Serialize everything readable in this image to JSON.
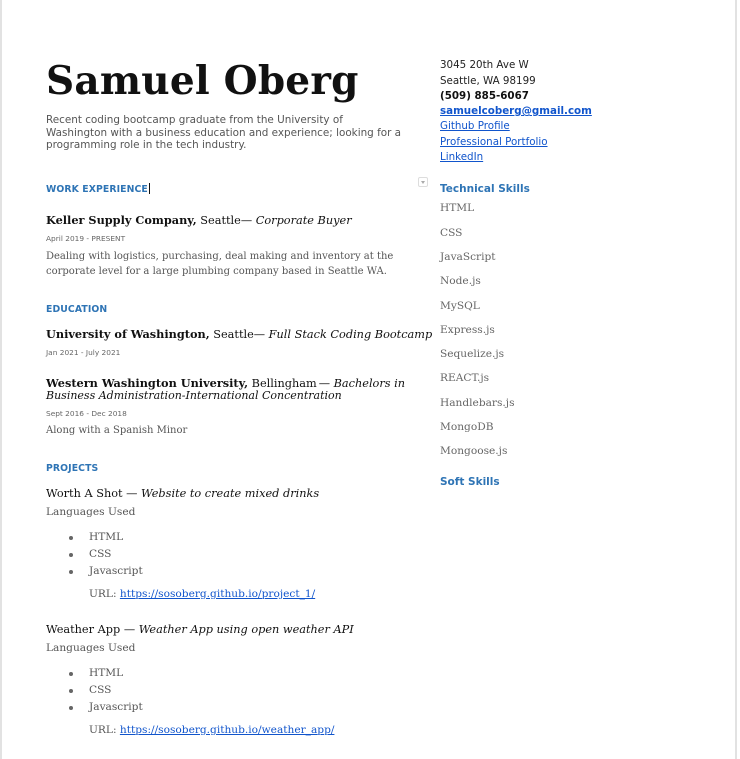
{
  "header": {
    "name": "Samuel Oberg",
    "summary": "Recent coding bootcamp graduate from the University of Washington with a business education and experience; looking for a programming role in the tech industry."
  },
  "contact": {
    "street": "3045 20th Ave W",
    "city": "Seattle, WA 98199",
    "phone": "(509) 885-6067",
    "email": "samuelcoberg@gmail.com",
    "github": "Github Profile",
    "portfolio": "Professional Portfolio",
    "linkedin": "LinkedIn"
  },
  "work": {
    "heading": "WORK EXPERIENCE",
    "jobs": [
      {
        "company": "Keller Supply Company,",
        "location": " Seattle",
        "role": "— Corporate Buyer",
        "dates": "April 2019 - PRESENT",
        "description": "Dealing with logistics, purchasing, deal making and inventory at the corporate level for a large plumbing company based in Seattle WA."
      }
    ]
  },
  "education": {
    "heading": "EDUCATION",
    "schools": [
      {
        "school": "University of Washington,",
        "location": " Seattle",
        "program": "— Full Stack Coding Bootcamp",
        "dates": "Jan 2021 - July 2021"
      },
      {
        "school": "Western Washington University,",
        "location": " Bellingham",
        "program": "— Bachelors in",
        "program_line2": "Business Administration-International Concentration",
        "dates": "Sept 2016 - Dec 2018",
        "note": "Along with a Spanish Minor"
      }
    ]
  },
  "projects": {
    "heading": "PROJECTS",
    "items": [
      {
        "name": "Worth A Shot",
        "dash": " — ",
        "desc": "Website to create mixed drinks",
        "languages_label": "Languages Used",
        "languages": [
          "HTML",
          "CSS",
          "Javascript"
        ],
        "url_label": "URL: ",
        "url": "https://sosoberg.github.io/project_1/"
      },
      {
        "name": "Weather App",
        "dash": " — ",
        "desc": "Weather App using open weather API",
        "languages_label": "Languages Used",
        "languages": [
          "HTML",
          "CSS",
          "Javascript"
        ],
        "url_label": "URL: ",
        "url": "https://sosoberg.github.io/weather_app/"
      }
    ]
  },
  "skills": {
    "technical_heading": "Technical Skills",
    "technical": [
      "HTML",
      "CSS",
      "JavaScript",
      "Node.js",
      "MySQL",
      "Express.js",
      "Sequelize.js",
      "REACT.js",
      "Handlebars.js",
      "MongoDB",
      "Mongoose.js"
    ],
    "soft_heading": "Soft Skills"
  }
}
